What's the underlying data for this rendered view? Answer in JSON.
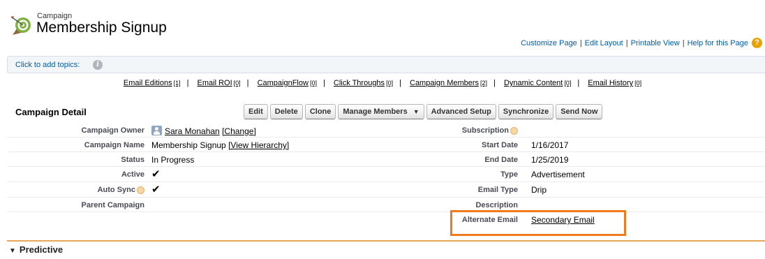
{
  "header": {
    "object_type": "Campaign",
    "title": "Membership Signup"
  },
  "page_links": {
    "customize": "Customize Page",
    "edit_layout": "Edit Layout",
    "printable": "Printable View",
    "help": "Help for this Page"
  },
  "topics": {
    "label": "Click to add topics:"
  },
  "related_lists": [
    {
      "label": "Email Editions",
      "count": "[1]"
    },
    {
      "label": "Email ROI",
      "count": "[0]"
    },
    {
      "label": "CampaignFlow",
      "count": "[0]"
    },
    {
      "label": "Click Throughs",
      "count": "[0]"
    },
    {
      "label": "Campaign Members",
      "count": "[2]"
    },
    {
      "label": "Dynamic Content",
      "count": "[0]"
    },
    {
      "label": "Email History",
      "count": "[0]"
    }
  ],
  "detail": {
    "section_title": "Campaign Detail",
    "buttons": {
      "edit": "Edit",
      "delete": "Delete",
      "clone": "Clone",
      "manage_members": "Manage Members",
      "advanced_setup": "Advanced Setup",
      "synchronize": "Synchronize",
      "send_now": "Send Now"
    },
    "fields": {
      "owner_label": "Campaign Owner",
      "owner_name": "Sara Monahan",
      "owner_change": "[Change]",
      "name_label": "Campaign Name",
      "name_value": "Membership Signup",
      "name_hierarchy": "[View Hierarchy]",
      "status_label": "Status",
      "status_value": "In Progress",
      "active_label": "Active",
      "active_value": "✔",
      "autosync_label": "Auto Sync",
      "autosync_value": "✔",
      "parent_label": "Parent Campaign",
      "subscription_label": "Subscription",
      "start_label": "Start Date",
      "start_value": "1/16/2017",
      "end_label": "End Date",
      "end_value": "1/25/2019",
      "type_label": "Type",
      "type_value": "Advertisement",
      "email_type_label": "Email Type",
      "email_type_value": "Drip",
      "description_label": "Description",
      "alt_email_label": "Alternate Email",
      "alt_email_value": "Secondary Email"
    }
  },
  "sections": {
    "predictive": "Predictive"
  },
  "colors": {
    "link": "#015ba7",
    "highlight": "#f07a1e",
    "section_rule": "#e8a85a"
  }
}
